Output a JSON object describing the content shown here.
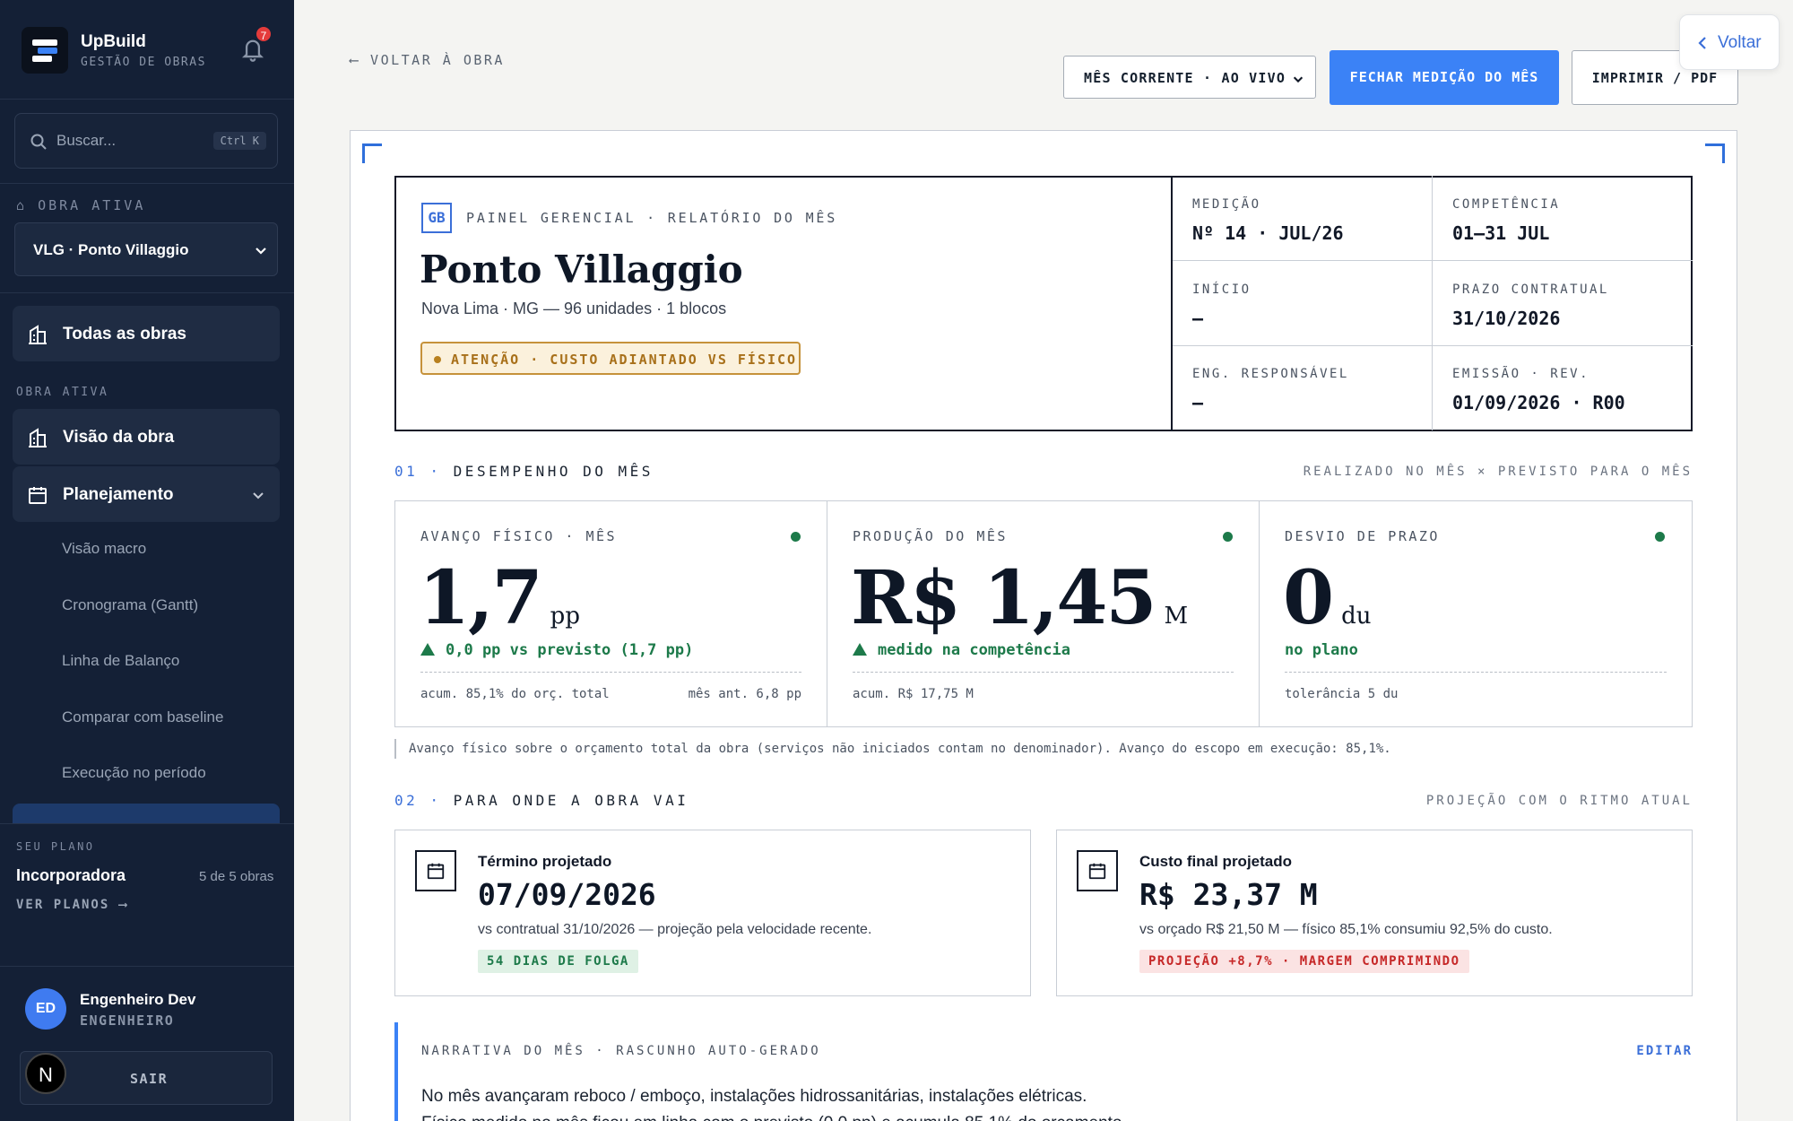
{
  "sidebar": {
    "brand_name": "UpBuild",
    "brand_sub": "GESTÃO DE OBRAS",
    "notifications_count": "7",
    "search_placeholder": "Buscar...",
    "search_shortcut": "Ctrl K",
    "active_obra_label": "OBRA ATIVA",
    "active_obra_value": "VLG · Ponto Villaggio",
    "all_obras": "Todas as obras",
    "section_label": "OBRA ATIVA",
    "items": [
      {
        "label": "Visão da obra"
      },
      {
        "label": "Planejamento"
      }
    ],
    "sub_items": [
      {
        "label": "Visão macro"
      },
      {
        "label": "Cronograma (Gantt)"
      },
      {
        "label": "Linha de Balanço"
      },
      {
        "label": "Comparar com baseline"
      },
      {
        "label": "Execução no período"
      }
    ],
    "plan": {
      "label": "SEU PLANO",
      "name": "Incorporadora",
      "count": "5 de 5 obras",
      "link": "VER PLANOS ⟶"
    },
    "user": {
      "initials": "ED",
      "name": "Engenheiro Dev",
      "role": "ENGENHEIRO",
      "logout": "SAIR",
      "n_badge": "N"
    }
  },
  "toolbar": {
    "back": "⟵ VOLTAR À OBRA",
    "period": "MÊS CORRENTE · AO VIVO",
    "close_btn": "FECHAR MEDIÇÃO DO MÊS",
    "print_btn": "IMPRIMIR / PDF",
    "voltar": "Voltar"
  },
  "report": {
    "badge": "GB",
    "eyebrow": "PAINEL GERENCIAL · RELATÓRIO DO MÊS",
    "title": "Ponto Villaggio",
    "subtitle": "Nova Lima · MG — 96 unidades · 1 blocos",
    "alert": "ATENÇÃO · CUSTO ADIANTADO VS FÍSICO",
    "meta": [
      {
        "k": "MEDIÇÃO",
        "v": "Nº 14 · JUL/26"
      },
      {
        "k": "COMPETÊNCIA",
        "v": "01–31 JUL"
      },
      {
        "k": "INÍCIO",
        "v": "—"
      },
      {
        "k": "PRAZO CONTRATUAL",
        "v": "31/10/2026"
      },
      {
        "k": "ENG. RESPONSÁVEL",
        "v": "—"
      },
      {
        "k": "EMISSÃO · REV.",
        "v": "01/09/2026 · R00"
      }
    ]
  },
  "section1": {
    "num": "01 ·",
    "title": "DESEMPENHO DO MÊS",
    "right": "REALIZADO NO MÊS × PREVISTO PARA O MÊS",
    "kpis": [
      {
        "k": "AVANÇO FÍSICO · MÊS",
        "big": "1,7",
        "unit": "pp",
        "delta": "0,0 pp vs previsto (1,7 pp)",
        "foot": "acum. 85,1% do orç. total",
        "foot_r": "mês ant. 6,8 pp"
      },
      {
        "k": "PRODUÇÃO DO MÊS",
        "big": "R$ 1,45",
        "unit": "M",
        "delta": "medido na competência",
        "foot": "acum. R$ 17,75 M",
        "foot_r": ""
      },
      {
        "k": "DESVIO DE PRAZO",
        "big": "0",
        "unit": "du",
        "delta": "no plano",
        "foot": "tolerância 5 du",
        "foot_r": ""
      }
    ],
    "note": "Avanço físico sobre o orçamento total da obra (serviços não iniciados contam no denominador). Avanço do escopo em execução: 85,1%."
  },
  "section2": {
    "num": "02 ·",
    "title": "PARA ONDE A OBRA VAI",
    "right": "PROJEÇÃO COM O RITMO ATUAL",
    "cards": [
      {
        "t": "Término projetado",
        "v": "07/09/2026",
        "d": "vs contratual 31/10/2026 — projeção pela velocidade recente.",
        "tag": "54 DIAS DE FOLGA"
      },
      {
        "t": "Custo final projetado",
        "v": "R$ 23,37 M",
        "d": "vs orçado R$ 21,50 M — físico 85,1% consumiu 92,5% do custo.",
        "tag": "PROJEÇÃO +8,7% · MARGEM COMPRIMINDO"
      }
    ]
  },
  "narrative": {
    "label": "NARRATIVA DO MÊS · RASCUNHO AUTO-GERADO",
    "edit": "EDITAR",
    "text": "No mês avançaram reboco / emboço, instalações hidrossanitárias, instalações elétricas.",
    "text2": "Físico medido no mês ficou em linha com o previsto (0,0 pp) e acumula 85,1% do orçamento."
  },
  "colors": {
    "accent": "#3b82f6",
    "sidebar": "#142036",
    "ok": "#1d7a4a",
    "warn": "#a8701a",
    "danger": "#c62828"
  }
}
